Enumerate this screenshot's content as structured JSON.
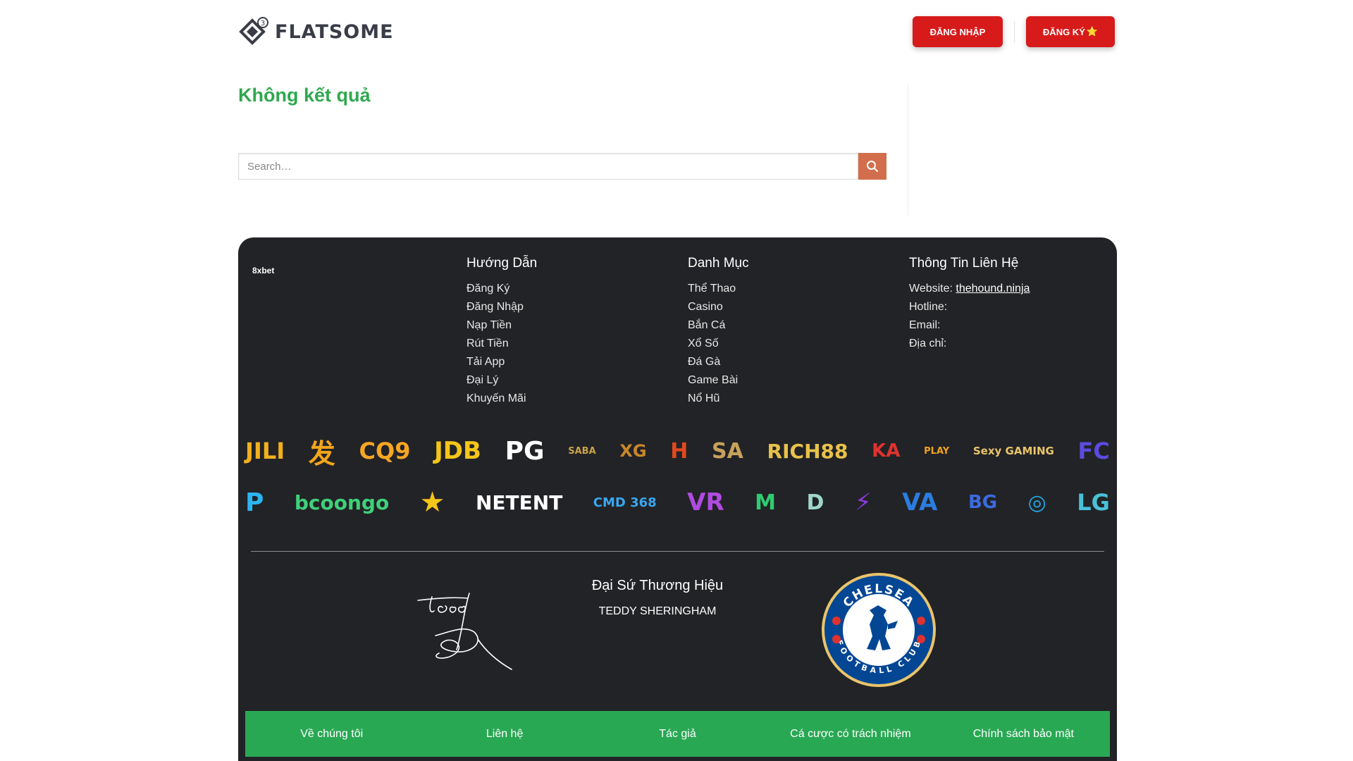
{
  "header": {
    "logo_text": "FLATSOME",
    "logo_badge": "3",
    "login_label": "ĐĂNG NHẬP",
    "register_label": "ĐĂNG KÝ",
    "register_star": "⭐"
  },
  "main": {
    "title": "Không kết quả",
    "search_placeholder": "Search…"
  },
  "footer": {
    "brand": "8xbet",
    "guide": {
      "title": "Hướng Dẫn",
      "items": [
        "Đăng Ký",
        "Đăng Nhập",
        "Nạp Tiền",
        "Rút Tiền",
        "Tải App",
        "Đại Lý",
        "Khuyến Mãi"
      ]
    },
    "categories": {
      "title": "Danh Mục",
      "items": [
        "Thể Thao",
        "Casino",
        "Bắn Cá",
        "Xổ Số",
        "Đá Gà",
        "Game Bài",
        "Nổ Hũ"
      ]
    },
    "contact": {
      "title": "Thông Tin Liên Hệ",
      "website_label": "Website:",
      "website_value": "thehound.ninja",
      "hotline_label": "Hotline:",
      "email_label": "Email:",
      "address_label": "Địa chỉ:"
    },
    "providers_row1": [
      {
        "text": "JILI",
        "color": "#f2b01e"
      },
      {
        "text": "发",
        "color": "#f2a51a"
      },
      {
        "text": "CQ9",
        "color": "#f5a623"
      },
      {
        "text": "JDB",
        "color": "#f5c518"
      },
      {
        "text": "PG",
        "color": "#ffffff"
      },
      {
        "text": "SABA",
        "color": "#c9a34a"
      },
      {
        "text": "XG",
        "color": "#c8862c"
      },
      {
        "text": "H",
        "color": "#e2481f"
      },
      {
        "text": "SA",
        "color": "#c8a25c"
      },
      {
        "text": "RICH88",
        "color": "#e8c24a"
      },
      {
        "text": "KA",
        "color": "#e0322f"
      },
      {
        "text": "PLAY",
        "color": "#f0a31b"
      },
      {
        "text": "Sexy GAMING",
        "color": "#e8c46b"
      },
      {
        "text": "FC",
        "color": "#5b4be0"
      }
    ],
    "providers_row2": [
      {
        "text": "P",
        "color": "#2bb5f0"
      },
      {
        "text": "bcoongo",
        "color": "#3fd07a"
      },
      {
        "text": "★",
        "color": "#f5c518"
      },
      {
        "text": "NETENT",
        "color": "#ffffff"
      },
      {
        "text": "CMD 368",
        "color": "#3aa6f0"
      },
      {
        "text": "VR",
        "color": "#b04be0"
      },
      {
        "text": "M",
        "color": "#2ecc71"
      },
      {
        "text": "D",
        "color": "#9fd8c8"
      },
      {
        "text": "⚡",
        "color": "#8a3be0"
      },
      {
        "text": "VA",
        "color": "#2b7de0"
      },
      {
        "text": "BG",
        "color": "#3b6be0"
      },
      {
        "text": "◎",
        "color": "#1fa8e0"
      },
      {
        "text": "LG",
        "color": "#49c0d8"
      }
    ],
    "ambassador_title": "Đại Sứ Thương Hiệu",
    "ambassador_name": "TEDDY SHERINGHAM",
    "crest_top": "CHELSEA",
    "crest_bottom": "FOOTBALL CLUB",
    "bottom_links": [
      "Về chúng tôi",
      "Liên hệ",
      "Tác giả",
      "Cá cược có trách nhiệm",
      "Chính sách bảo mật"
    ]
  },
  "colors": {
    "accent_green": "#2fa84f",
    "button_red": "#d71a1a",
    "search_button": "#d26e4b",
    "footer_bg": "#222326",
    "bottom_bar": "#29a854"
  }
}
